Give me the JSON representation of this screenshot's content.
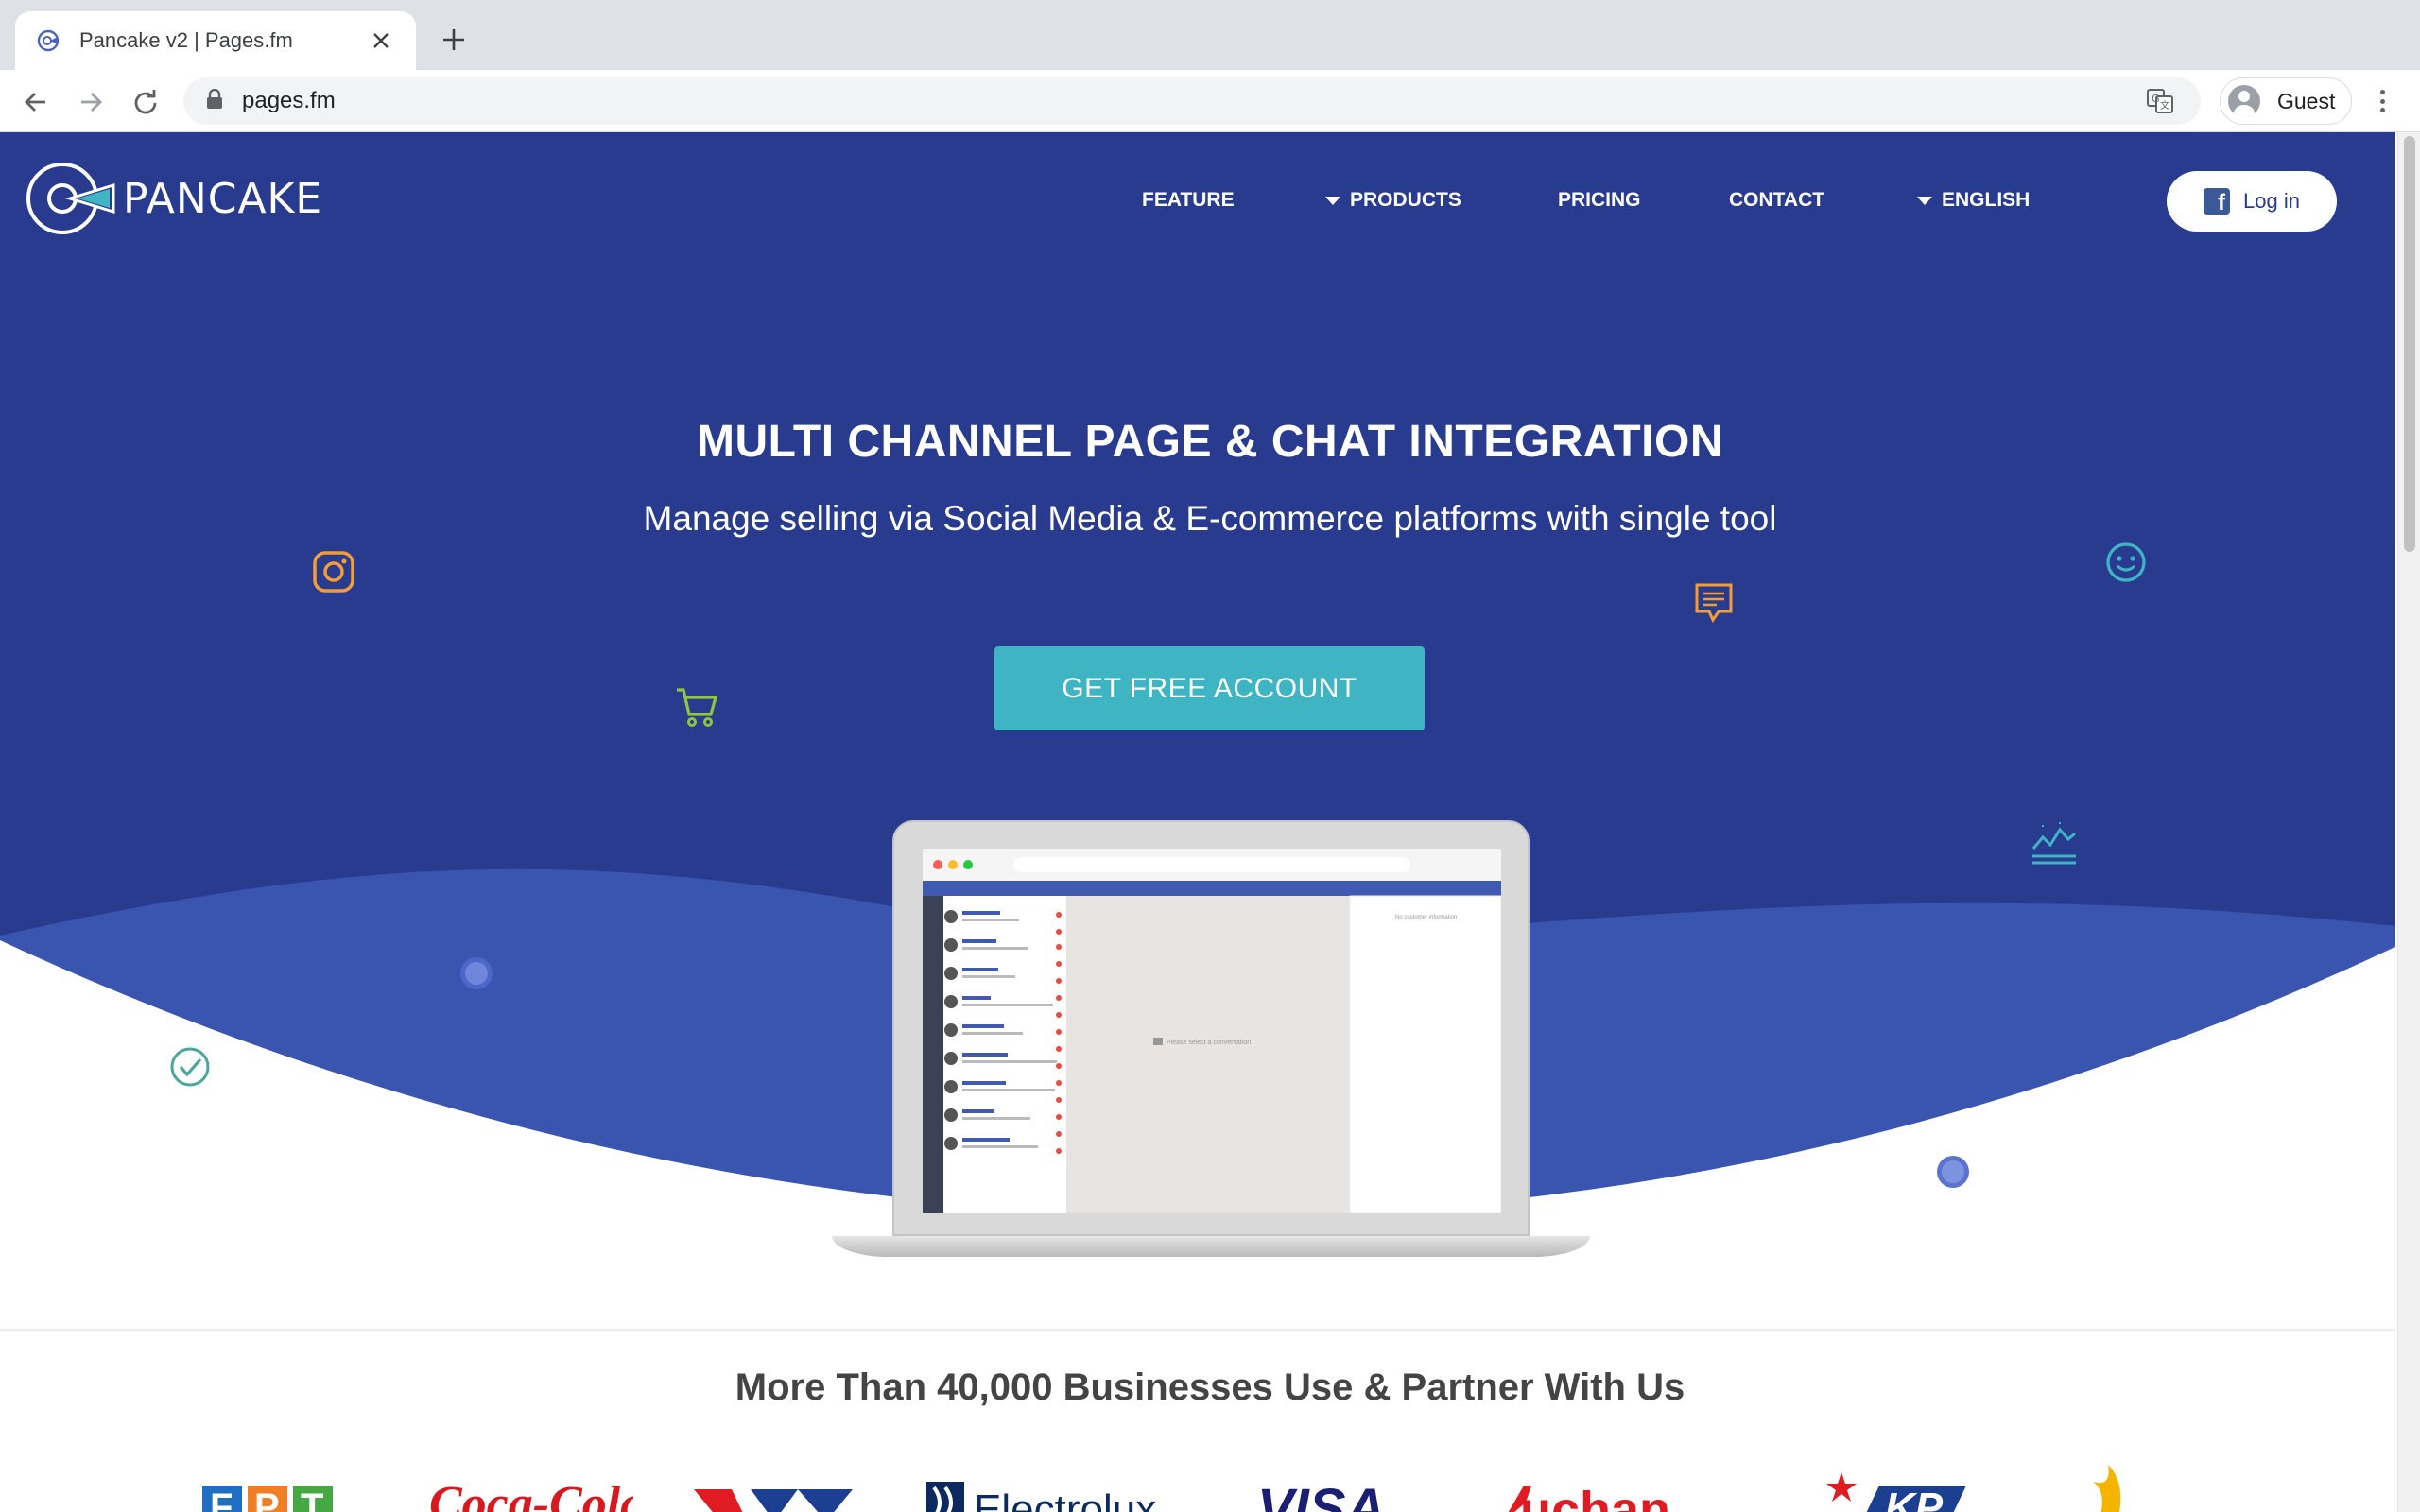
{
  "browser": {
    "tab_title": "Pancake v2 | Pages.fm",
    "url": "pages.fm",
    "profile_label": "Guest",
    "icons": [
      "back-arrow-icon",
      "forward-arrow-icon",
      "reload-icon",
      "lock-icon",
      "translate-icon",
      "profile-icon",
      "more-icon",
      "close-icon",
      "plus-icon"
    ]
  },
  "site": {
    "logo_text": "PANCAKE",
    "nav": {
      "feature": "FEATURE",
      "products": "PRODUCTS",
      "pricing": "PRICING",
      "contact": "CONTACT",
      "language": "ENGLISH"
    },
    "login_label": "Log in"
  },
  "hero": {
    "title": "MULTI CHANNEL PAGE & CHAT INTEGRATION",
    "subtitle": "Manage selling via Social Media & E-commerce platforms with single tool",
    "cta_label": "GET FREE ACCOUNT",
    "laptop_screen_hint": "Please select a conversation",
    "laptop_side_hint": "No customer information"
  },
  "partners": {
    "title": "More Than 40,000 Businesses Use & Partner With Us",
    "logos": [
      "FPT",
      "Coca-Cola",
      "VTV",
      "Electrolux",
      "VISA",
      "Auchan",
      "KP",
      "logo"
    ]
  },
  "colors": {
    "hero_bg": "#283b8e",
    "wave_mid": "#3a55b0",
    "wave_light": "#4562bd",
    "cta": "#3fb5c3",
    "facebook": "#3b5998"
  }
}
